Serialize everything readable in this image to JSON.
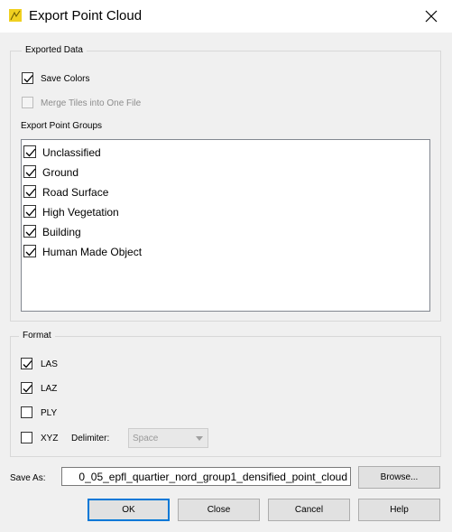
{
  "window": {
    "title": "Export Point Cloud"
  },
  "exported_data": {
    "legend": "Exported Data",
    "save_colors": {
      "label": "Save Colors",
      "checked": true
    },
    "merge_tiles": {
      "label": "Merge Tiles into One File",
      "checked": false,
      "disabled": true
    },
    "groups_label": "Export Point Groups",
    "groups": [
      {
        "label": "Unclassified",
        "checked": true
      },
      {
        "label": "Ground",
        "checked": true
      },
      {
        "label": "Road Surface",
        "checked": true
      },
      {
        "label": "High Vegetation",
        "checked": true
      },
      {
        "label": "Building",
        "checked": true
      },
      {
        "label": "Human Made Object",
        "checked": true
      }
    ]
  },
  "format": {
    "legend": "Format",
    "las": {
      "label": "LAS",
      "checked": true
    },
    "laz": {
      "label": "LAZ",
      "checked": true
    },
    "ply": {
      "label": "PLY",
      "checked": false
    },
    "xyz": {
      "label": "XYZ",
      "checked": false
    },
    "delimiter_label": "Delimiter:",
    "delimiter_value": "Space"
  },
  "save_as": {
    "label": "Save As:",
    "value": "0_05_epfl_quartier_nord_group1_densified_point_cloud",
    "browse_label": "Browse..."
  },
  "buttons": {
    "ok": "OK",
    "close": "Close",
    "cancel": "Cancel",
    "help": "Help"
  },
  "colors": {
    "accent": "#0078d7",
    "background": "#f0f0f0",
    "app_icon": "#f0d020"
  }
}
